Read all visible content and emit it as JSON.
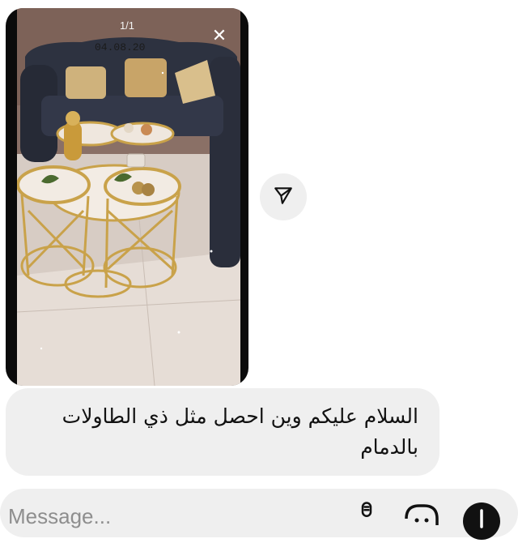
{
  "story": {
    "counter": "1/1",
    "photo_date_stamp": "04.08.20",
    "close_symbol": "✕"
  },
  "message": {
    "text": "السلام عليكم وين احصل مثل ذي الطاولات بالدمام"
  },
  "composer": {
    "placeholder": "Message..."
  },
  "icons": {
    "share": "paper-plane-icon",
    "mic": "microphone-icon",
    "sticker": "sticker-icon",
    "plus": "plus-icon"
  },
  "colors": {
    "bubble_bg": "#efefef",
    "text": "#111111",
    "placeholder": "#8e8e8e"
  }
}
